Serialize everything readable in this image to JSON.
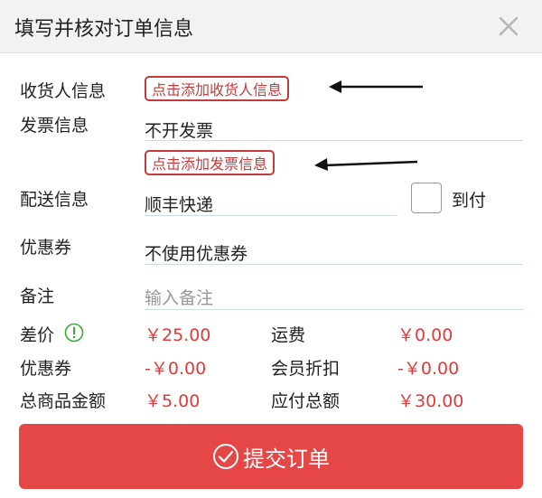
{
  "header": {
    "title": "填写并核对订单信息",
    "close_icon": "close-icon"
  },
  "recipient": {
    "label": "收货人信息",
    "button": "点击添加收货人信息"
  },
  "invoice": {
    "label": "发票信息",
    "value": "不开发票",
    "button": "点击添加发票信息"
  },
  "delivery": {
    "label": "配送信息",
    "value": "顺丰快递",
    "cod_label": "到付",
    "cod_checked": false
  },
  "coupon": {
    "label": "优惠券",
    "value": "不使用优惠券"
  },
  "remark": {
    "label": "备注",
    "placeholder": "输入备注"
  },
  "summary": {
    "diff_label": "差价",
    "diff_value": "￥25.00",
    "diff_icon": "info-icon",
    "shipping_label": "运费",
    "shipping_value": "￥0.00",
    "coupon_label": "优惠券",
    "coupon_value": "-￥0.00",
    "member_label": "会员折扣",
    "member_value": "-￥0.00",
    "total_label": "总商品金额",
    "total_value": "￥5.00",
    "payable_label": "应付总额",
    "payable_value": "￥30.00"
  },
  "submit": {
    "label": "提交订单",
    "icon": "check-circle-icon"
  },
  "colors": {
    "accent": "#e54646",
    "price": "#e03b3b",
    "outline_button": "#c43b3b"
  }
}
